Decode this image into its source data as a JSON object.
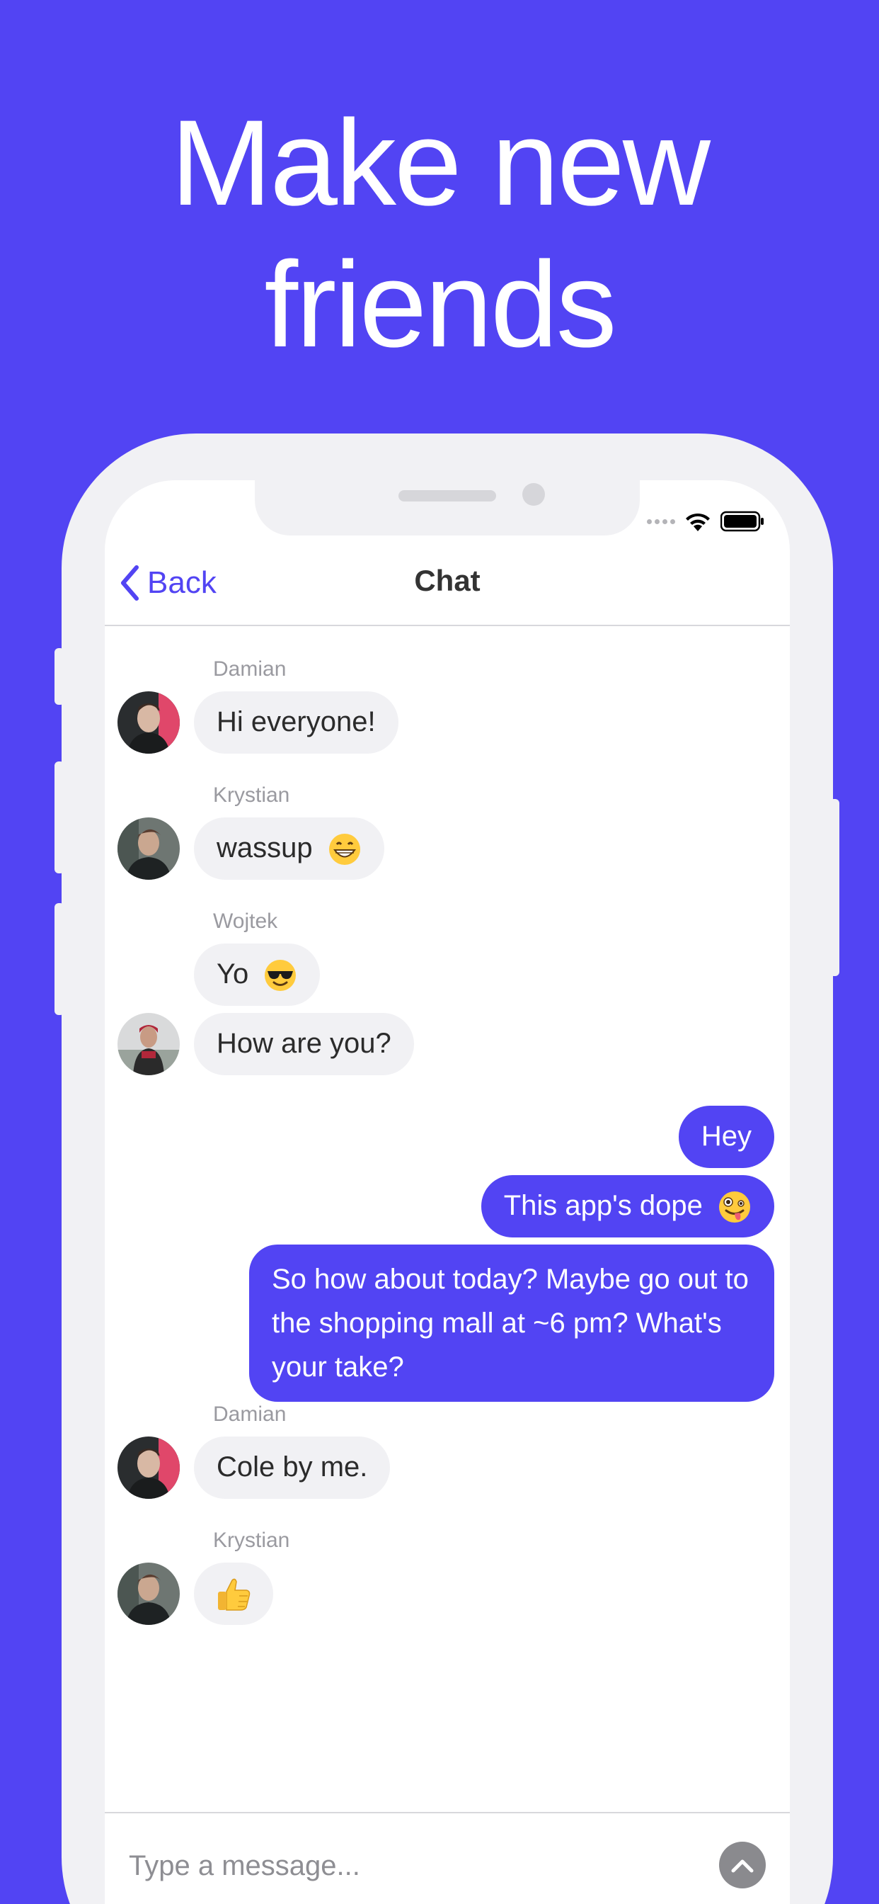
{
  "headline": {
    "line1": "Make new",
    "line2": "friends"
  },
  "nav": {
    "back_label": "Back",
    "title": "Chat"
  },
  "colors": {
    "accent": "#5244F3",
    "incoming_bubble": "#F1F1F4",
    "frame": "#F1F1F4"
  },
  "messages": {
    "m1": {
      "sender": "Damian",
      "text": "Hi everyone!"
    },
    "m2": {
      "sender": "Krystian",
      "text": "wassup"
    },
    "m3": {
      "sender": "Wojtek",
      "text": "Yo"
    },
    "m4": {
      "text": "How are you?"
    },
    "m5": {
      "text": "Hey"
    },
    "m6": {
      "text": "This app's dope"
    },
    "m7": {
      "text": "So how about today? Maybe go out to the shopping mall at ~6 pm? What's your take?"
    },
    "m8": {
      "sender": "Damian",
      "text": "Cole by me."
    },
    "m9": {
      "sender": "Krystian"
    }
  },
  "composer": {
    "placeholder": "Type a message..."
  },
  "icons": {
    "back": "chevron-left-icon",
    "send": "chevron-up-icon",
    "wifi": "wifi-icon",
    "battery": "battery-icon"
  }
}
